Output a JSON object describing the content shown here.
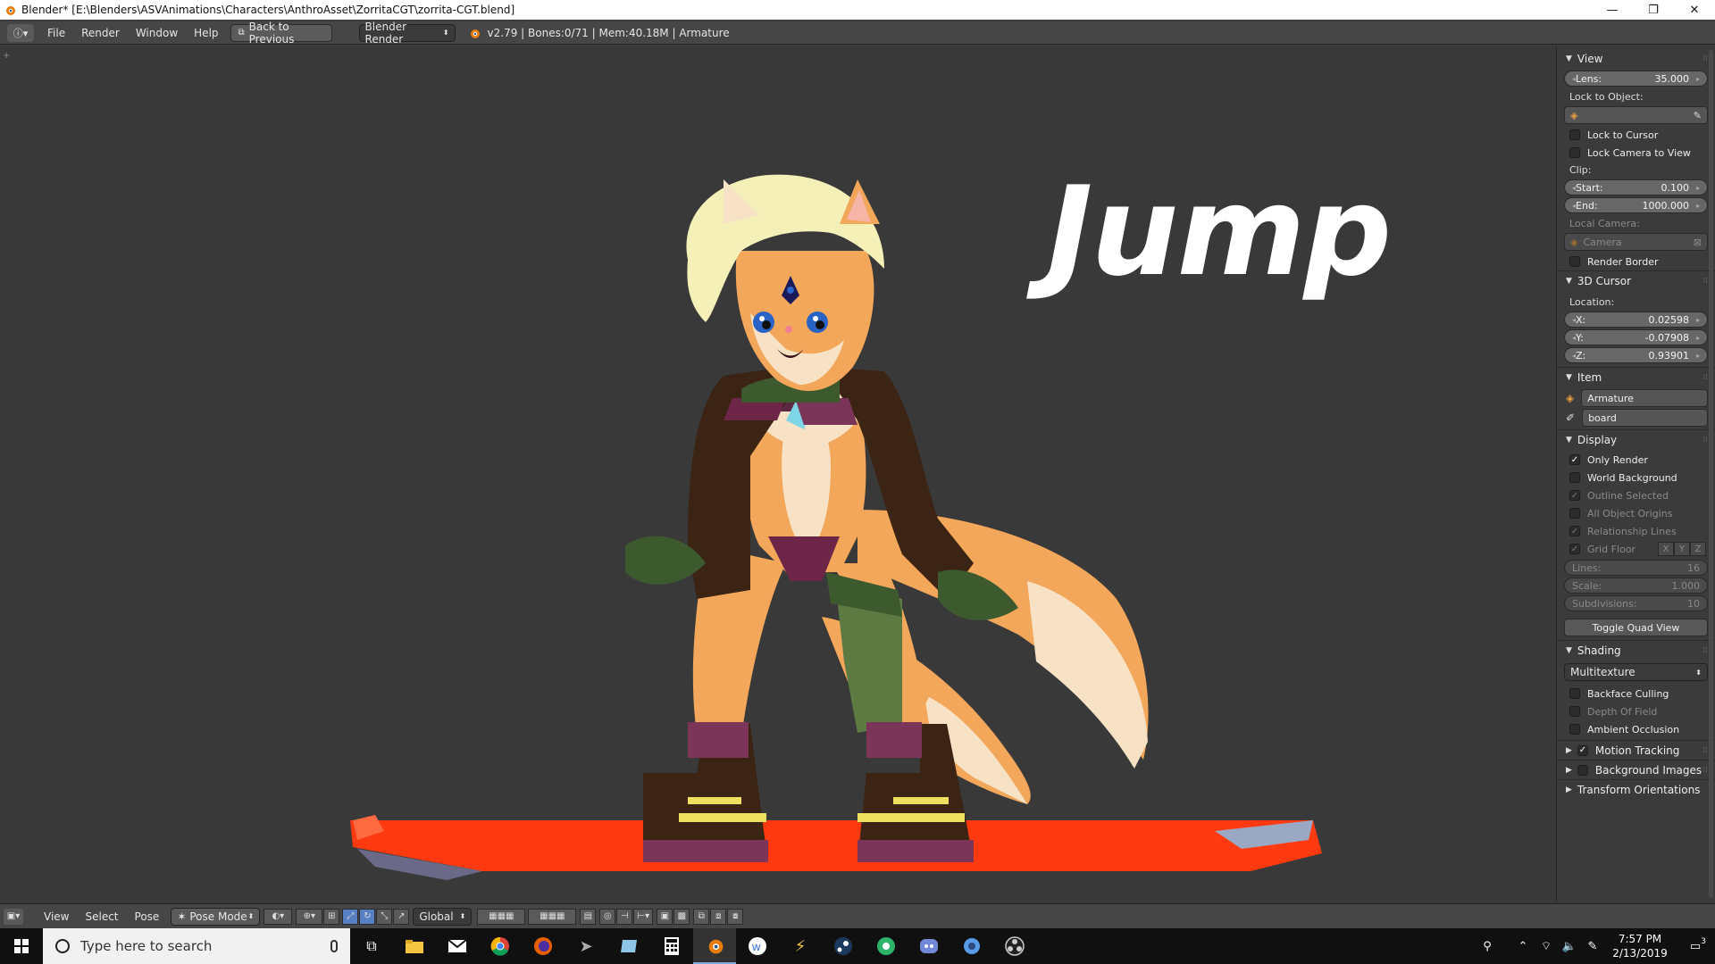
{
  "window": {
    "title": "Blender* [E:\\Blenders\\ASVAnimations\\Characters\\AnthroAsset\\ZorritaCGT\\zorrita-CGT.blend]",
    "controls": [
      "minimize",
      "restore",
      "close"
    ]
  },
  "info_header": {
    "menus": [
      "File",
      "Render",
      "Window",
      "Help"
    ],
    "back_button": "Back to Previous",
    "render_engine": "Blender Render",
    "stats": "v2.79 | Bones:0/71 | Mem:40.18M | Armature"
  },
  "viewport": {
    "overlay_text": "Jump"
  },
  "properties_panel": {
    "view": {
      "header": "View",
      "lens_label": "Lens:",
      "lens_value": "35.000",
      "lock_to_object": "Lock to Object:",
      "lock_to_cursor": "Lock to Cursor",
      "lock_camera_to_view": "Lock Camera to View",
      "clip_label": "Clip:",
      "clip_start_label": "Start:",
      "clip_start_value": "0.100",
      "clip_end_label": "End:",
      "clip_end_value": "1000.000",
      "local_camera_label": "Local Camera:",
      "local_camera_value": "Camera",
      "render_border": "Render Border"
    },
    "cursor": {
      "header": "3D Cursor",
      "location_label": "Location:",
      "x_label": "X:",
      "x_value": "0.02598",
      "y_label": "Y:",
      "y_value": "-0.07908",
      "z_label": "Z:",
      "z_value": "0.93901"
    },
    "item": {
      "header": "Item",
      "object_name": "Armature",
      "bone_name": "board"
    },
    "display": {
      "header": "Display",
      "only_render": "Only Render",
      "world_background": "World Background",
      "outline_selected": "Outline Selected",
      "all_object_origins": "All Object Origins",
      "relationship_lines": "Relationship Lines",
      "grid_floor": "Grid Floor",
      "axis_x": "X",
      "axis_y": "Y",
      "axis_z": "Z",
      "lines_label": "Lines:",
      "lines_value": "16",
      "scale_label": "Scale:",
      "scale_value": "1.000",
      "subdivisions_label": "Subdivisions:",
      "subdivisions_value": "10",
      "toggle_quad_view": "Toggle Quad View"
    },
    "shading": {
      "header": "Shading",
      "mode": "Multitexture",
      "backface_culling": "Backface Culling",
      "depth_of_field": "Depth Of Field",
      "ambient_occlusion": "Ambient Occlusion"
    },
    "collapsed": {
      "motion_tracking": "Motion Tracking",
      "background_images": "Background Images",
      "transform_orientations": "Transform Orientations"
    }
  },
  "view3d_header": {
    "menus": [
      "View",
      "Select",
      "Pose"
    ],
    "mode": "Pose Mode",
    "orientation": "Global"
  },
  "taskbar": {
    "search_placeholder": "Type here to search",
    "time": "7:57 PM",
    "date": "2/13/2019",
    "notification_count": "3"
  },
  "colors": {
    "viewport_bg": "#393939",
    "panel_bg": "#3b3b3b",
    "header_bg": "#464646",
    "board_orange": "#ff3a10",
    "fur_orange": "#f2a75a"
  }
}
